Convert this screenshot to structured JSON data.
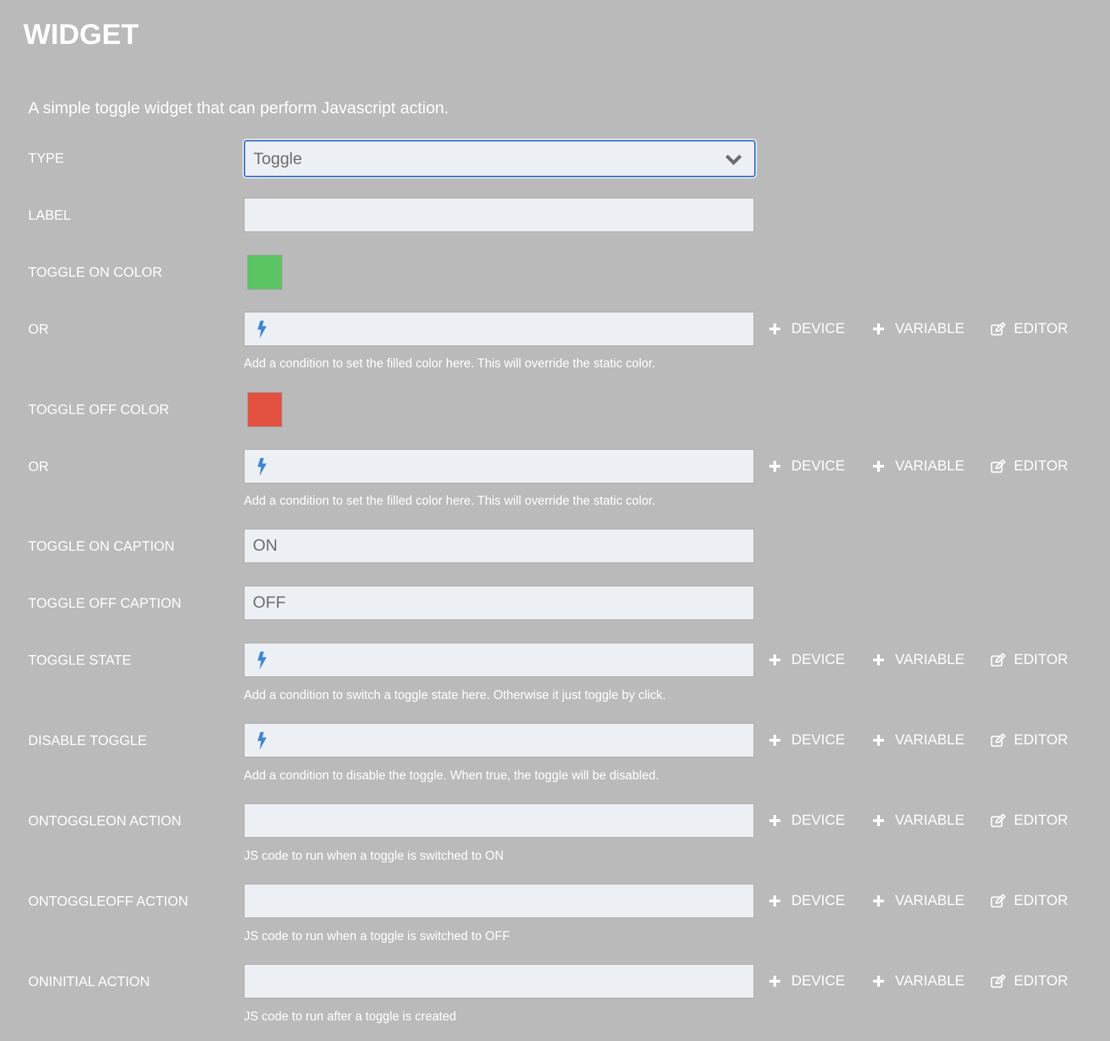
{
  "header": {
    "title": "WIDGET"
  },
  "description": "A simple toggle widget that can perform Javascript action.",
  "action_labels": {
    "device": "DEVICE",
    "variable": "VARIABLE",
    "editor": "EDITOR"
  },
  "fields": {
    "type": {
      "label": "TYPE",
      "value": "Toggle"
    },
    "label": {
      "label": "LABEL",
      "value": ""
    },
    "toggle_on_color": {
      "label": "TOGGLE ON COLOR",
      "color": "#5bc463"
    },
    "on_color_or": {
      "label": "OR",
      "help": "Add a condition to set the filled color here. This will override the static color."
    },
    "toggle_off_color": {
      "label": "TOGGLE OFF COLOR",
      "color": "#e35140"
    },
    "off_color_or": {
      "label": "OR",
      "help": "Add a condition to set the filled color here. This will override the static color."
    },
    "toggle_on_caption": {
      "label": "TOGGLE ON CAPTION",
      "value": "ON"
    },
    "toggle_off_caption": {
      "label": "TOGGLE OFF CAPTION",
      "value": "OFF"
    },
    "toggle_state": {
      "label": "TOGGLE STATE",
      "help": "Add a condition to switch a toggle state here. Otherwise it just toggle by click."
    },
    "disable_toggle": {
      "label": "DISABLE TOGGLE",
      "help": "Add a condition to disable the toggle. When true, the toggle will be disabled."
    },
    "ontoggleon_action": {
      "label": "ONTOGGLEON ACTION",
      "help": "JS code to run when a toggle is switched to ON"
    },
    "ontoggleoff_action": {
      "label": "ONTOGGLEOFF ACTION",
      "help": "JS code to run when a toggle is switched to OFF"
    },
    "oninitial_action": {
      "label": "ONINITIAL ACTION",
      "help": "JS code to run after a toggle is created"
    }
  },
  "icons": {
    "bolt": "bolt-icon",
    "plus": "plus-icon",
    "edit": "edit-icon",
    "chevron": "chevron-down-icon"
  }
}
